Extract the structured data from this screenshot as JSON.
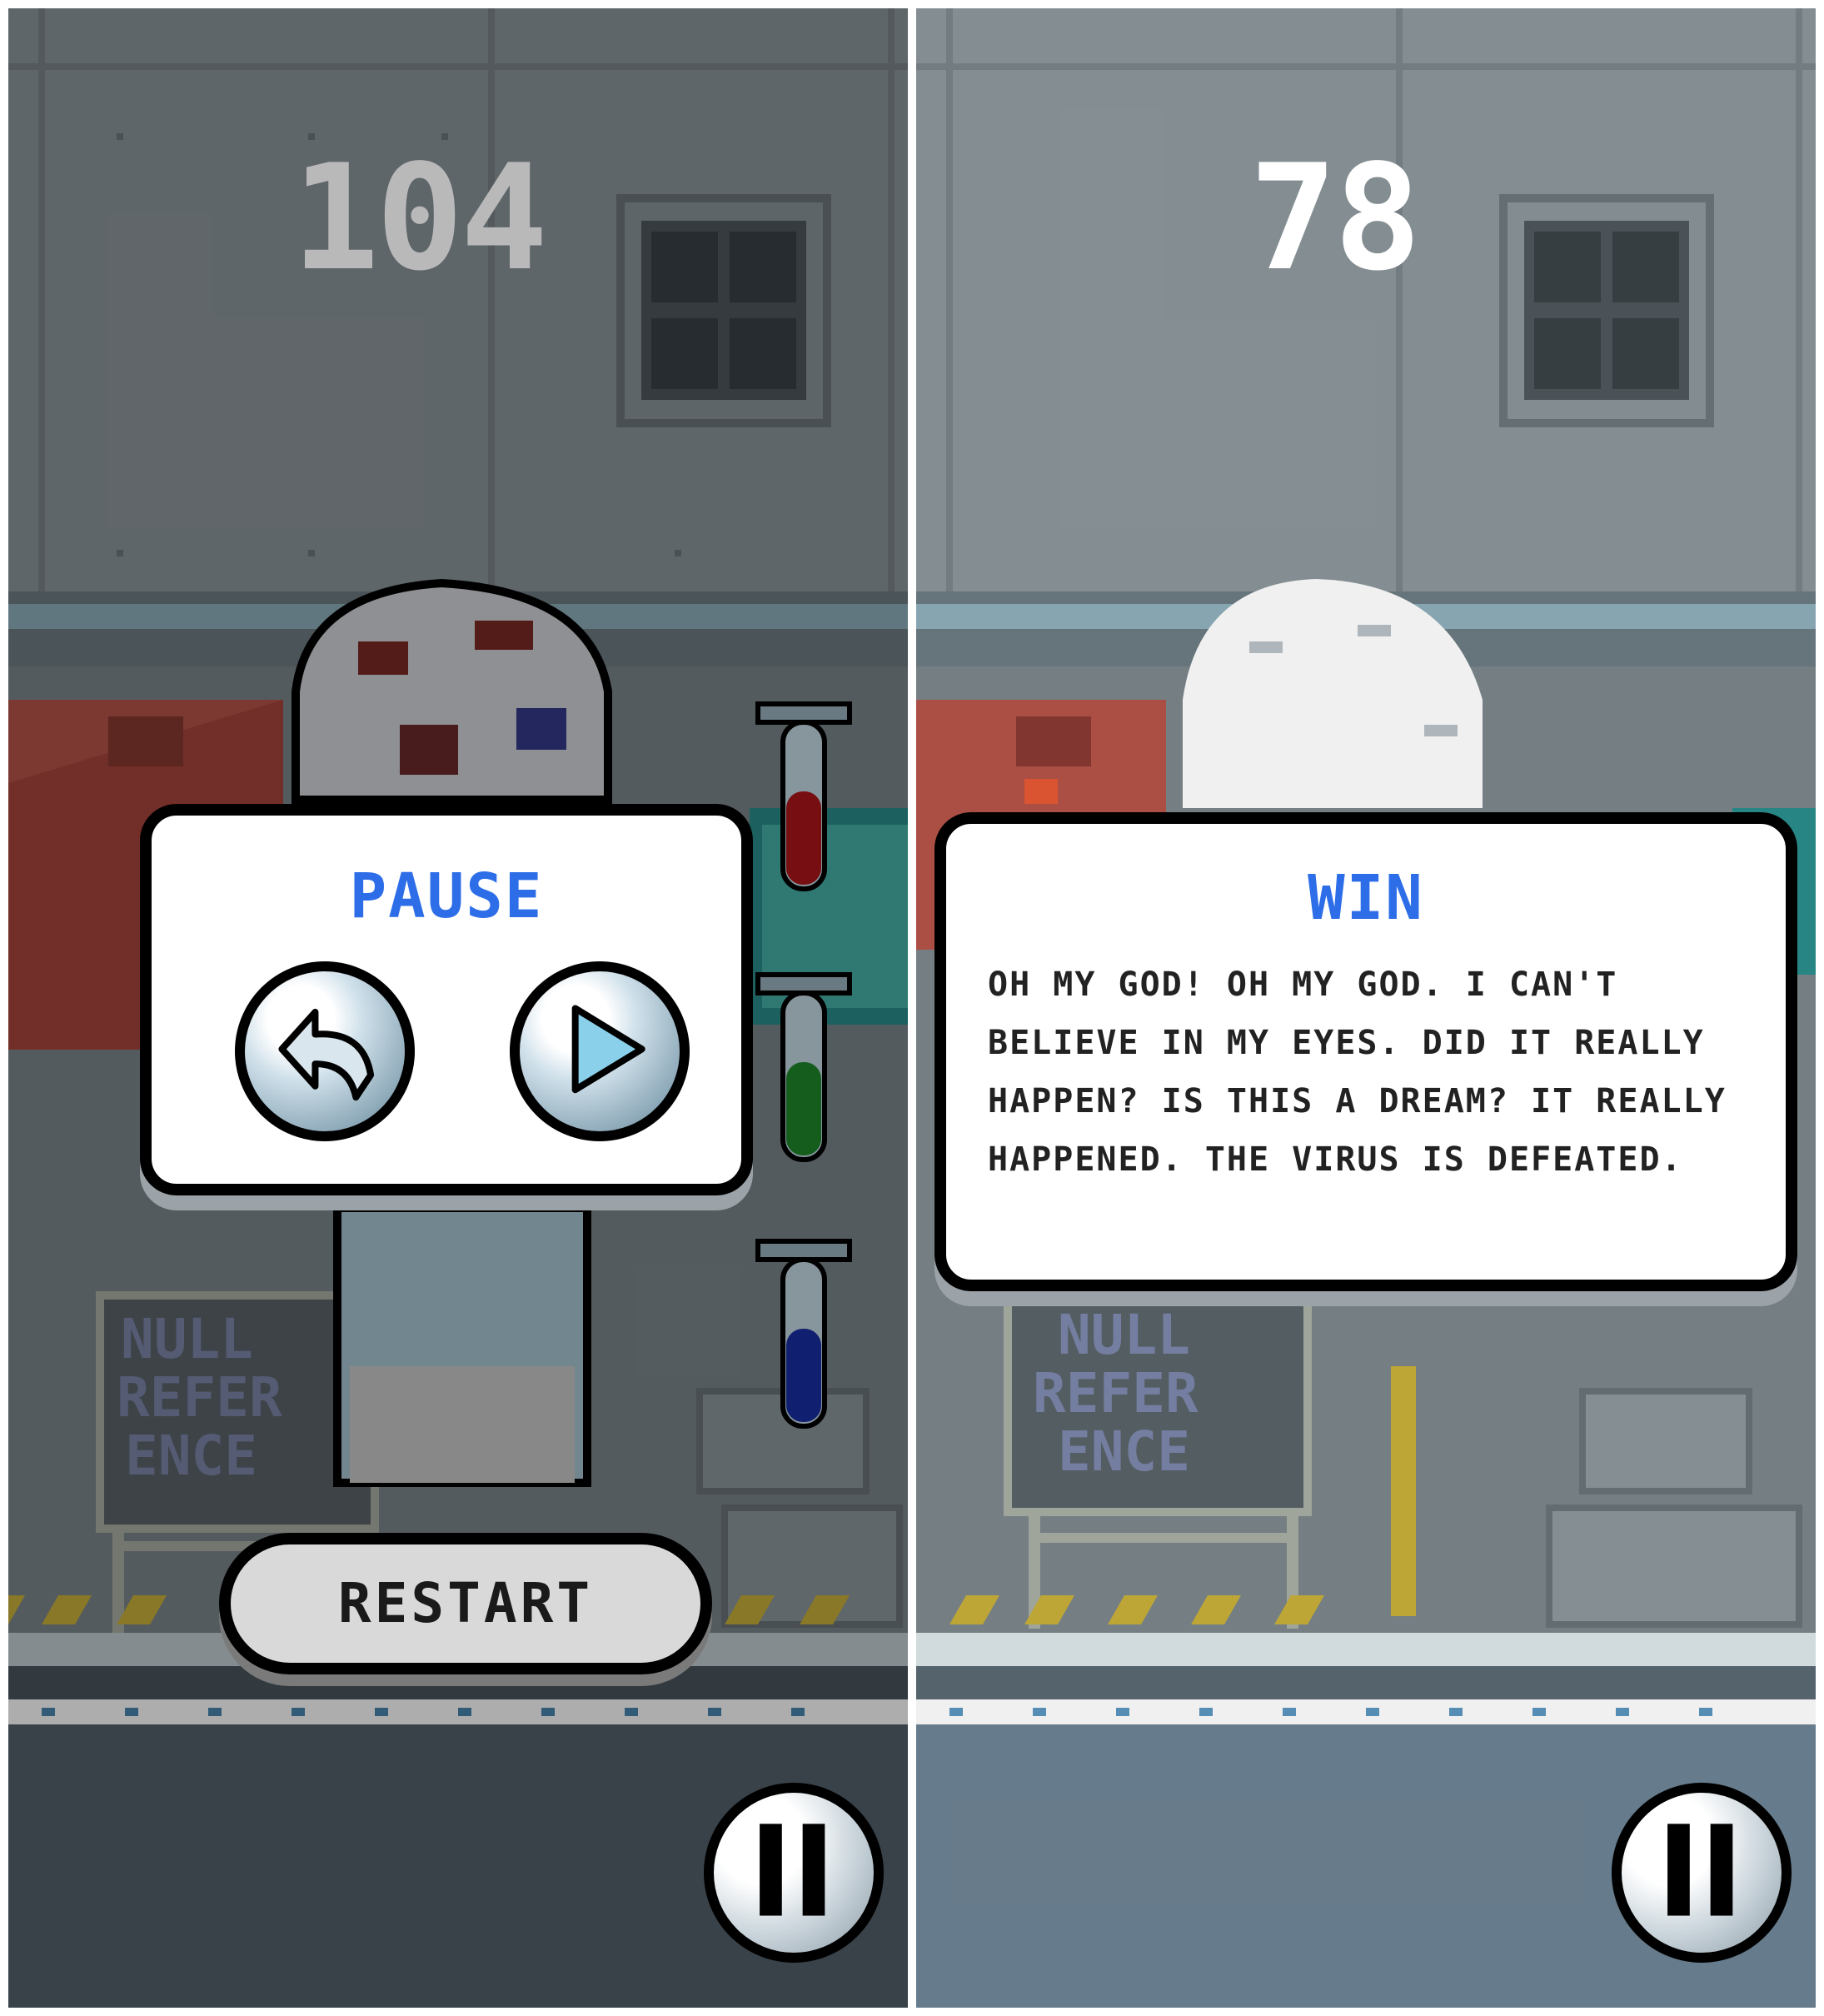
{
  "screens": [
    {
      "id": "pause",
      "score": "104",
      "dialog": {
        "title": "PAUSE"
      },
      "buttons": {
        "back": "back-arrow-icon",
        "resume": "play-icon",
        "restart": "RESTART",
        "pause": "pause-icon"
      },
      "scene": {
        "sign_text": [
          "NULL",
          "REFER",
          "ENCE"
        ],
        "vials": [
          "red",
          "green",
          "blue"
        ]
      }
    },
    {
      "id": "win",
      "score": "78",
      "dialog": {
        "title": "WIN",
        "message": "OH MY GOD! OH MY GOD. I CAN'T BELIEVE IN MY EYES. DID IT REALLY HAPPEN? IS THIS A DREAM? IT REALLY HAPPENED. THE VIRUS IS DEFEATED."
      },
      "buttons": {
        "pause": "pause-icon"
      },
      "scene": {
        "sign_text": [
          "NULL",
          "REFER",
          "ENCE"
        ]
      }
    }
  ],
  "colors": {
    "accent": "#2d6ee8",
    "wall": "#6f7a80",
    "floor": "#3d4a55",
    "vial_red": "#b0151a",
    "vial_green": "#1e8a2c",
    "vial_blue": "#1a2fa6"
  }
}
